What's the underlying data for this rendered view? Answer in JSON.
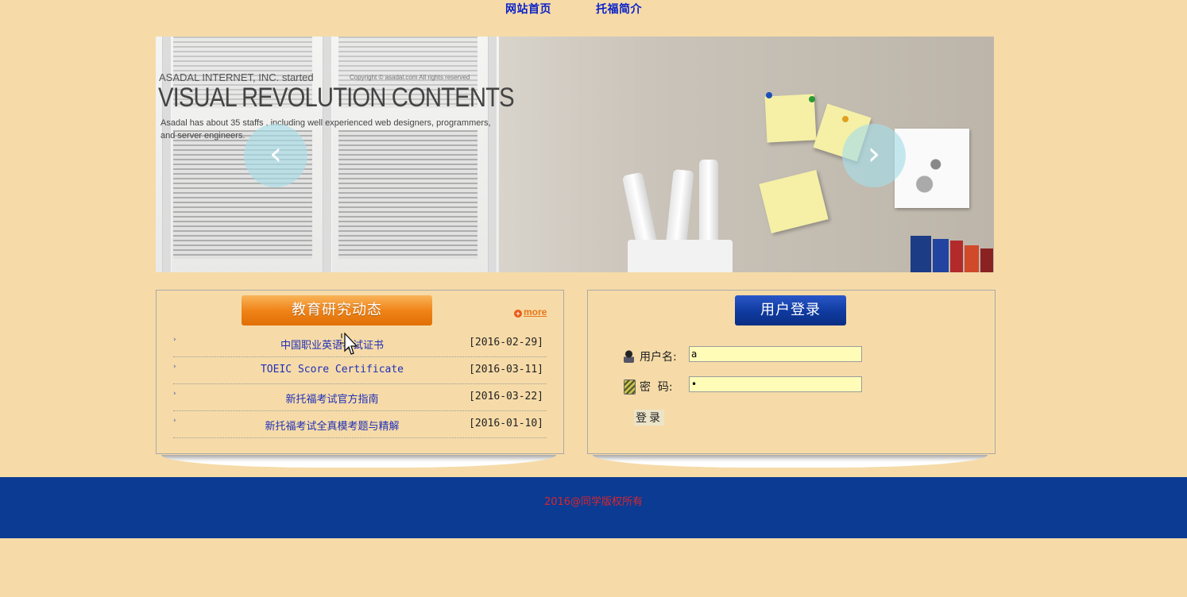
{
  "nav": {
    "home": "网站首页",
    "intro": "托福简介"
  },
  "banner": {
    "subtitle": "ASADAL INTERNET, INC. started",
    "copyright": "Copyright © asadal.com All rights reserved",
    "title": "VISUAL REVOLUTION CONTENTS",
    "description": "Asadal has about 35 staffs , including well experienced web designers, programmers, and server engineers.",
    "prev_icon": "chevron-left-icon",
    "next_icon": "chevron-right-icon",
    "prev_glyph": "‹",
    "next_glyph": "›"
  },
  "news": {
    "title": "教育研究动态",
    "more": "more",
    "more_glyph": "+",
    "bullet_glyph": "›",
    "items": [
      {
        "title": "中国职业英语考试证书",
        "date": "[2016-02-29]"
      },
      {
        "title": "TOEIC Score Certificate",
        "date": "[2016-03-11]"
      },
      {
        "title": "新托福考试官方指南",
        "date": "[2016-03-22]"
      },
      {
        "title": "新托福考试全真模考题与精解",
        "date": "[2016-01-10]"
      }
    ]
  },
  "login": {
    "title": "用户登录",
    "username_label": "用户名:",
    "username_value": "a",
    "password_label": "密  码:",
    "password_value": "a",
    "submit": "登录"
  },
  "footer": {
    "copyright": "2016@同学版权所有"
  },
  "colors": {
    "background": "#f6dba8",
    "nav_link": "#0b22c8",
    "news_header": "#f08418",
    "login_header": "#0f3a9e",
    "footer": "#0b3b93",
    "footer_text": "#d8262e",
    "input_bg": "#fffcb8"
  }
}
